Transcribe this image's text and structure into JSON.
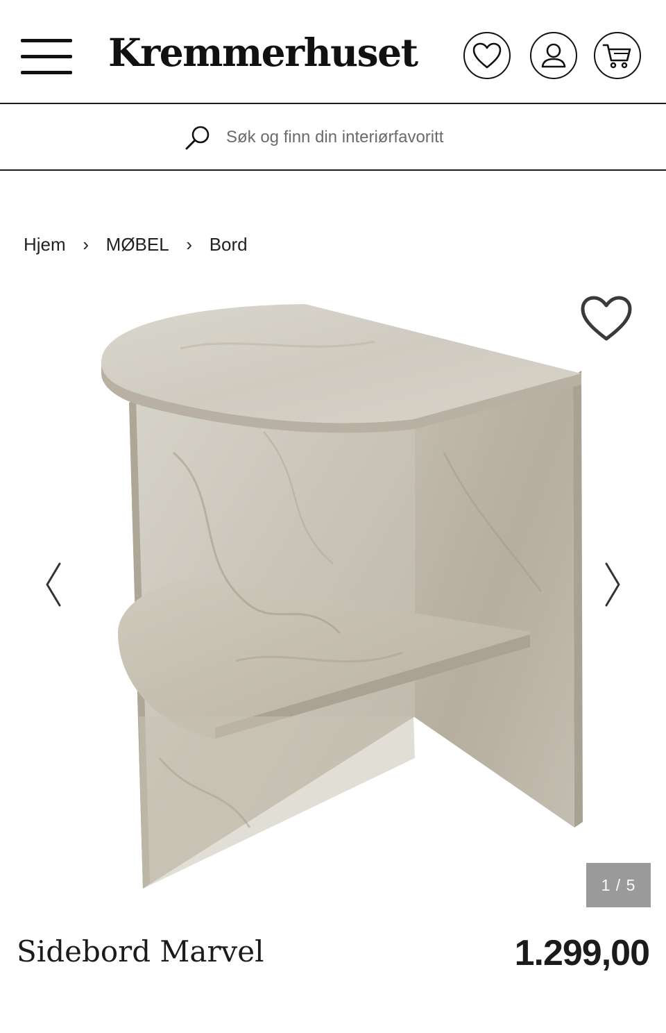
{
  "header": {
    "logo_text": "Kremmerhuset",
    "icons": [
      "menu-icon",
      "heart-icon",
      "user-icon",
      "cart-icon"
    ]
  },
  "search": {
    "placeholder": "Søk og finn din interiørfavoritt"
  },
  "breadcrumb": {
    "items": [
      "Hjem",
      "MØBEL",
      "Bord"
    ],
    "separator": "›"
  },
  "gallery": {
    "counter": "1 / 5",
    "current": 1,
    "total": 5
  },
  "product": {
    "name": "Sidebord Marvel",
    "price": "1.299,00"
  },
  "colors": {
    "text": "#1b1b1b",
    "counter_bg": "#9a9a9a",
    "marble_light": "#d9d6cc",
    "marble_mid": "#c4bfb2"
  }
}
